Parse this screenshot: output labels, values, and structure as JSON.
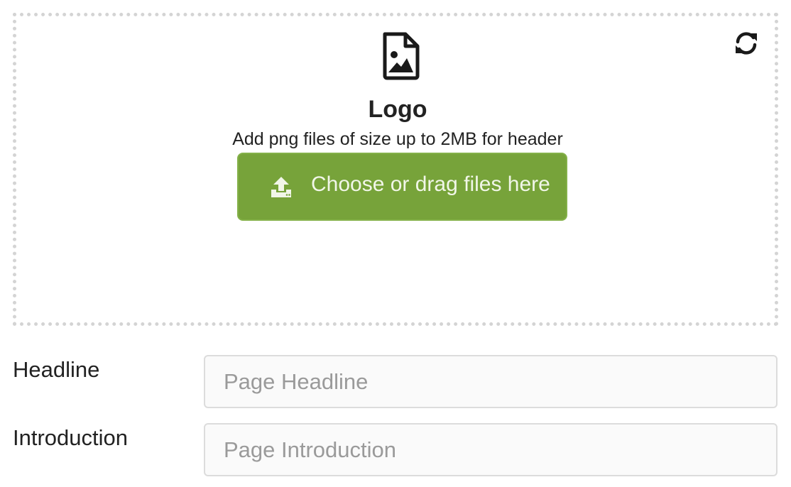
{
  "upload": {
    "title": "Logo",
    "description": "Add png files of size up to 2MB for header",
    "button_label": "Choose or drag files here",
    "button_color": "#77a33a",
    "icons": {
      "file": "file-image-icon",
      "refresh": "refresh-icon",
      "upload": "upload-icon"
    }
  },
  "fields": {
    "headline": {
      "label": "Headline",
      "placeholder": "Page Headline",
      "value": ""
    },
    "introduction": {
      "label": "Introduction",
      "placeholder": "Page Introduction",
      "value": ""
    }
  }
}
